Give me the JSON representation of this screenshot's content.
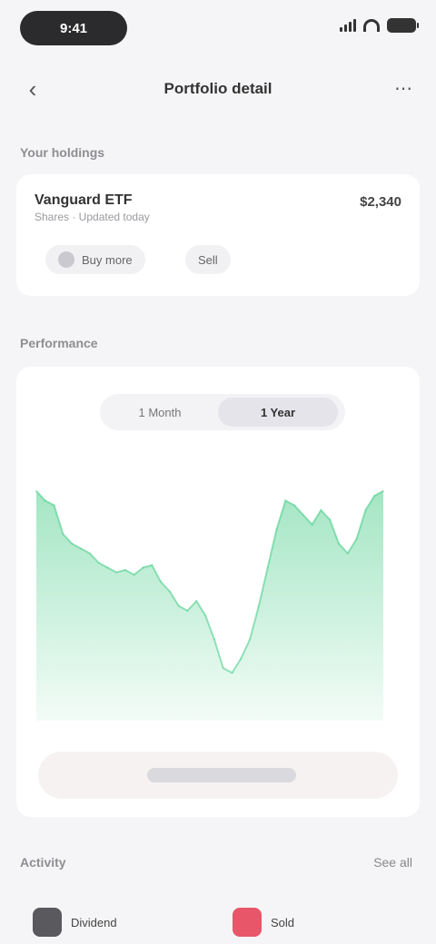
{
  "status_bar": {
    "time": "9:41"
  },
  "nav": {
    "back_glyph": "‹",
    "title": "Portfolio detail",
    "more_glyph": "⋯"
  },
  "holdings_section": {
    "label": "Your holdings"
  },
  "holding": {
    "name": "Vanguard ETF",
    "subtitle": "Shares · Updated today",
    "value": "$2,340",
    "chip_primary": "Buy more",
    "chip_secondary": "Sell"
  },
  "performance_section": {
    "label": "Performance"
  },
  "chart_toggle": {
    "off_label": "1 Month",
    "on_label": "1 Year"
  },
  "chart_data": {
    "type": "area",
    "series_color": "#34c77b",
    "grid": false,
    "x": [
      0,
      1,
      2,
      3,
      4,
      5,
      6,
      7,
      8,
      9,
      10,
      11,
      12,
      13,
      14,
      15,
      16,
      17,
      18,
      19,
      20,
      21,
      22,
      23,
      24,
      25,
      26,
      27,
      28,
      29,
      30,
      31,
      32,
      33,
      34,
      35,
      36,
      37,
      38,
      39
    ],
    "values": [
      96,
      92,
      90,
      78,
      74,
      72,
      70,
      66,
      64,
      62,
      63,
      61,
      64,
      65,
      58,
      54,
      48,
      46,
      50,
      44,
      34,
      22,
      20,
      26,
      34,
      48,
      64,
      80,
      92,
      90,
      86,
      82,
      88,
      84,
      74,
      70,
      76,
      88,
      94,
      96
    ],
    "ylim": [
      0,
      110
    ]
  },
  "bottom_section": {
    "label": "Activity",
    "link": "See all"
  },
  "bottom_items": [
    {
      "label": "Dividend"
    },
    {
      "label": "Sold"
    }
  ]
}
